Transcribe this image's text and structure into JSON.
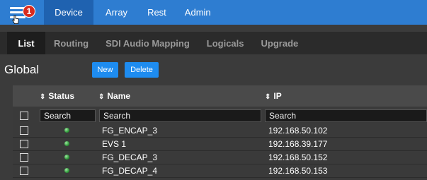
{
  "topnav": {
    "notification_count": "1",
    "tabs": [
      {
        "label": "Device",
        "active": true
      },
      {
        "label": "Array",
        "active": false
      },
      {
        "label": "Rest",
        "active": false
      },
      {
        "label": "Admin",
        "active": false
      }
    ]
  },
  "subnav": {
    "tabs": [
      {
        "label": "List",
        "active": true
      },
      {
        "label": "Routing",
        "active": false
      },
      {
        "label": "SDI Audio Mapping",
        "active": false
      },
      {
        "label": "Logicals",
        "active": false
      },
      {
        "label": "Upgrade",
        "active": false
      }
    ]
  },
  "header": {
    "title": "Global",
    "new_label": "New",
    "delete_label": "Delete"
  },
  "table": {
    "columns": {
      "status": "Status",
      "name": "Name",
      "ip": "IP"
    },
    "search_placeholder": "Search",
    "rows": [
      {
        "status": "online",
        "name": "FG_ENCAP_3",
        "ip": "192.168.50.102"
      },
      {
        "status": "online",
        "name": "EVS 1",
        "ip": "192.168.39.177"
      },
      {
        "status": "online",
        "name": "FG_DECAP_3",
        "ip": "192.168.50.152"
      },
      {
        "status": "online",
        "name": "FG_DECAP_4",
        "ip": "192.168.50.153"
      }
    ]
  },
  "colors": {
    "nav_blue": "#2e7dd1",
    "active_tab": "#1f62b0",
    "button_blue": "#1e8cf0",
    "badge_red": "#d92b1e",
    "status_green": "#2f9a3a"
  }
}
